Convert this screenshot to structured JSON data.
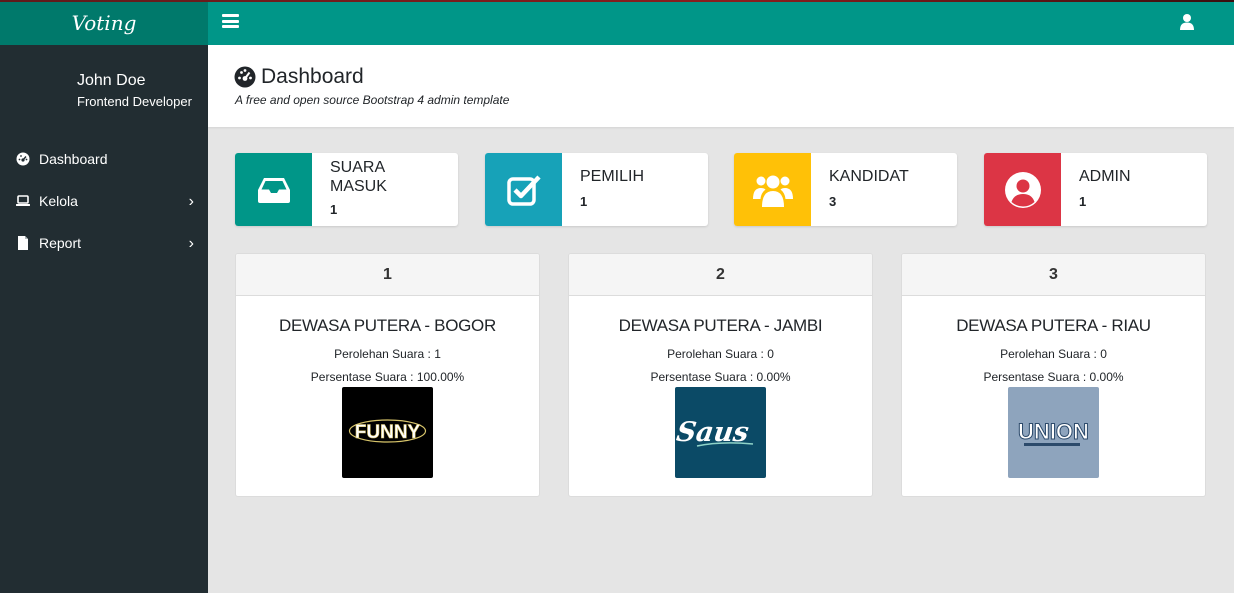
{
  "app": {
    "brand": "Voting"
  },
  "sidebar": {
    "user_name": "John Doe",
    "user_role": "Frontend Developer",
    "items": [
      {
        "label": "Dashboard",
        "icon": "dashboard-icon",
        "has_submenu": false
      },
      {
        "label": "Kelola",
        "icon": "laptop-icon",
        "has_submenu": true
      },
      {
        "label": "Report",
        "icon": "file-icon",
        "has_submenu": true
      }
    ],
    "chevron": "›"
  },
  "header": {
    "title": "Dashboard",
    "subtitle": "A free and open source Bootstrap 4 admin template"
  },
  "widgets": [
    {
      "title": "SUARA MASUK",
      "value": "1",
      "icon": "inbox-icon",
      "color": "#009688"
    },
    {
      "title": "PEMILIH",
      "value": "1",
      "icon": "check-square-icon",
      "color": "#17a2b8"
    },
    {
      "title": "KANDIDAT",
      "value": "3",
      "icon": "users-icon",
      "color": "#ffc107"
    },
    {
      "title": "ADMIN",
      "value": "1",
      "icon": "user-circle-icon",
      "color": "#dc3545"
    }
  ],
  "candidates": [
    {
      "number": "1",
      "name": "DEWASA PUTERA - BOGOR",
      "votes": "Perolehan Suara : 1",
      "percentage": "Persentase Suara : 100.00%",
      "logo_text": "FUNNY",
      "logo_bg": "#000000"
    },
    {
      "number": "2",
      "name": "DEWASA PUTERA - JAMBI",
      "votes": "Perolehan Suara : 0",
      "percentage": "Persentase Suara : 0.00%",
      "logo_text": "Saus",
      "logo_bg": "#0b4a66"
    },
    {
      "number": "3",
      "name": "DEWASA PUTERA - RIAU",
      "votes": "Perolehan Suara : 0",
      "percentage": "Persentase Suara : 0.00%",
      "logo_text": "UNION",
      "logo_bg": "#8ea4bd"
    }
  ]
}
